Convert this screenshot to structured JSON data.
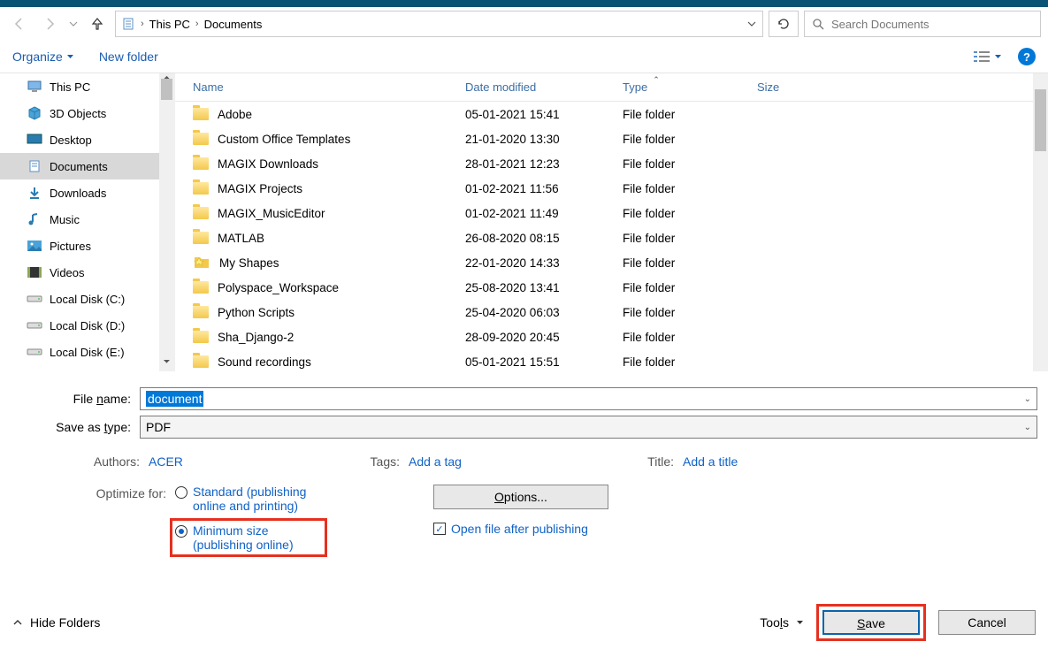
{
  "nav": {
    "breadcrumb": [
      "This PC",
      "Documents"
    ],
    "search_placeholder": "Search Documents"
  },
  "toolbar": {
    "organize": "Organize",
    "new_folder": "New folder"
  },
  "tree": {
    "items": [
      {
        "label": "This PC",
        "icon": "pc"
      },
      {
        "label": "3D Objects",
        "icon": "3d"
      },
      {
        "label": "Desktop",
        "icon": "desktop"
      },
      {
        "label": "Documents",
        "icon": "doc",
        "selected": true
      },
      {
        "label": "Downloads",
        "icon": "down"
      },
      {
        "label": "Music",
        "icon": "music"
      },
      {
        "label": "Pictures",
        "icon": "pic"
      },
      {
        "label": "Videos",
        "icon": "vid"
      },
      {
        "label": "Local Disk (C:)",
        "icon": "disk"
      },
      {
        "label": "Local Disk (D:)",
        "icon": "disk"
      },
      {
        "label": "Local Disk (E:)",
        "icon": "disk"
      }
    ]
  },
  "columns": {
    "name": "Name",
    "date": "Date modified",
    "type": "Type",
    "size": "Size"
  },
  "files": [
    {
      "name": "Adobe",
      "date": "05-01-2021 15:41",
      "type": "File folder"
    },
    {
      "name": "Custom Office Templates",
      "date": "21-01-2020 13:30",
      "type": "File folder"
    },
    {
      "name": "MAGIX Downloads",
      "date": "28-01-2021 12:23",
      "type": "File folder"
    },
    {
      "name": "MAGIX Projects",
      "date": "01-02-2021 11:56",
      "type": "File folder"
    },
    {
      "name": "MAGIX_MusicEditor",
      "date": "01-02-2021 11:49",
      "type": "File folder"
    },
    {
      "name": "MATLAB",
      "date": "26-08-2020 08:15",
      "type": "File folder"
    },
    {
      "name": "My Shapes",
      "date": "22-01-2020 14:33",
      "type": "File folder",
      "special": true
    },
    {
      "name": "Polyspace_Workspace",
      "date": "25-08-2020 13:41",
      "type": "File folder"
    },
    {
      "name": "Python Scripts",
      "date": "25-04-2020 06:03",
      "type": "File folder"
    },
    {
      "name": "Sha_Django-2",
      "date": "28-09-2020 20:45",
      "type": "File folder"
    },
    {
      "name": "Sound recordings",
      "date": "05-01-2021 15:51",
      "type": "File folder"
    }
  ],
  "fields": {
    "filename_label": "File name:",
    "filename_value": "document",
    "saveas_label": "Save as type:",
    "saveas_value": "PDF",
    "authors_label": "Authors:",
    "authors_value": "ACER",
    "tags_label": "Tags:",
    "tags_value": "Add a tag",
    "title_label": "Title:",
    "title_value": "Add a title"
  },
  "optimize": {
    "label": "Optimize for:",
    "standard": "Standard (publishing online and printing)",
    "minimum": "Minimum size (publishing online)"
  },
  "options_button": "Options...",
  "open_after": "Open file after publishing",
  "footer": {
    "hide_folders": "Hide Folders",
    "tools": "Tools",
    "save": "Save",
    "cancel": "Cancel"
  }
}
